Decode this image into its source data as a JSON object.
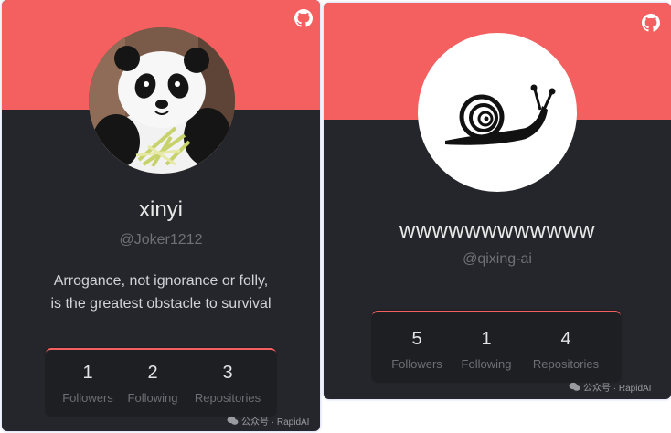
{
  "cards": [
    {
      "name": "xinyi",
      "handle": "@Joker1212",
      "bio_line1": "Arrogance, not ignorance or folly,",
      "bio_line2": "is the greatest obstacle to survival",
      "stats": [
        {
          "value": "1",
          "label": "Followers"
        },
        {
          "value": "2",
          "label": "Following"
        },
        {
          "value": "3",
          "label": "Repositories"
        }
      ],
      "avatar_icon": "panda-avatar",
      "corner_icon": "github-icon"
    },
    {
      "name": "wwwwwwwwwwww",
      "handle": "@qixing-ai",
      "stats": [
        {
          "value": "5",
          "label": "Followers"
        },
        {
          "value": "1",
          "label": "Following"
        },
        {
          "value": "4",
          "label": "Repositories"
        }
      ],
      "avatar_icon": "snail-avatar",
      "corner_icon": "github-icon"
    }
  ],
  "watermark": "公众号 · RapidAI",
  "colors": {
    "banner": "#f45f5f",
    "card_bg": "#25262b",
    "stats_bg": "#1e1f23",
    "name_text": "#e8e8e8",
    "muted_text": "#6f7176"
  }
}
